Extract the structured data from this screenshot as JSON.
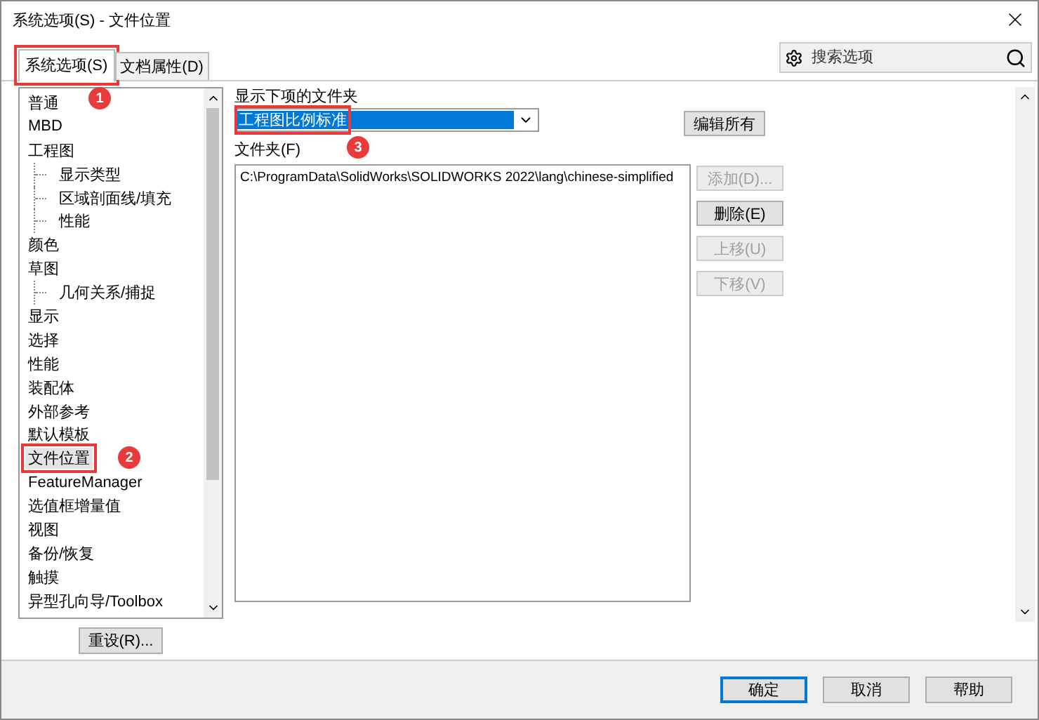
{
  "window": {
    "title": "系统选项(S) - 文件位置"
  },
  "tabs": [
    {
      "label": "系统选项(S)",
      "selected": true,
      "callout": "1"
    },
    {
      "label": "文档属性(D)",
      "selected": false
    }
  ],
  "search": {
    "placeholder": "搜索选项"
  },
  "tree": [
    {
      "label": "普通",
      "selected": false
    },
    {
      "label": "MBD",
      "selected": false
    },
    {
      "label": "工程图",
      "selected": false,
      "children": [
        {
          "label": "显示类型",
          "selected": false
        },
        {
          "label": "区域剖面线/填充",
          "selected": false
        },
        {
          "label": "性能",
          "selected": false
        }
      ]
    },
    {
      "label": "颜色",
      "selected": false
    },
    {
      "label": "草图",
      "selected": false,
      "children": [
        {
          "label": "几何关系/捕捉",
          "selected": false
        }
      ]
    },
    {
      "label": "显示",
      "selected": false
    },
    {
      "label": "选择",
      "selected": false
    },
    {
      "label": "性能",
      "selected": false
    },
    {
      "label": "装配体",
      "selected": false
    },
    {
      "label": "外部参考",
      "selected": false
    },
    {
      "label": "默认模板",
      "selected": false
    },
    {
      "label": "文件位置",
      "selected": true,
      "callout": "2"
    },
    {
      "label": "FeatureManager",
      "selected": false
    },
    {
      "label": "选值框增量值",
      "selected": false
    },
    {
      "label": "视图",
      "selected": false
    },
    {
      "label": "备份/恢复",
      "selected": false
    },
    {
      "label": "触摸",
      "selected": false
    },
    {
      "label": "异型孔向导/Toolbox",
      "selected": false
    }
  ],
  "reset_button": "重设(R)...",
  "show_folders": {
    "label": "显示下项的文件夹",
    "value": "工程图比例标准",
    "callout": "3"
  },
  "edit_all_button": "编辑所有",
  "folders": {
    "label": "文件夹(F)",
    "items": [
      "C:\\ProgramData\\SolidWorks\\SOLIDWORKS 2022\\lang\\chinese-simplified"
    ]
  },
  "side_buttons": [
    {
      "label": "添加(D)...",
      "disabled": true
    },
    {
      "label": "删除(E)",
      "disabled": false
    },
    {
      "label": "上移(U)",
      "disabled": true
    },
    {
      "label": "下移(V)",
      "disabled": true
    }
  ],
  "footer_buttons": [
    {
      "label": "确定",
      "default": true
    },
    {
      "label": "取消",
      "default": false
    },
    {
      "label": "帮助",
      "default": false
    }
  ]
}
